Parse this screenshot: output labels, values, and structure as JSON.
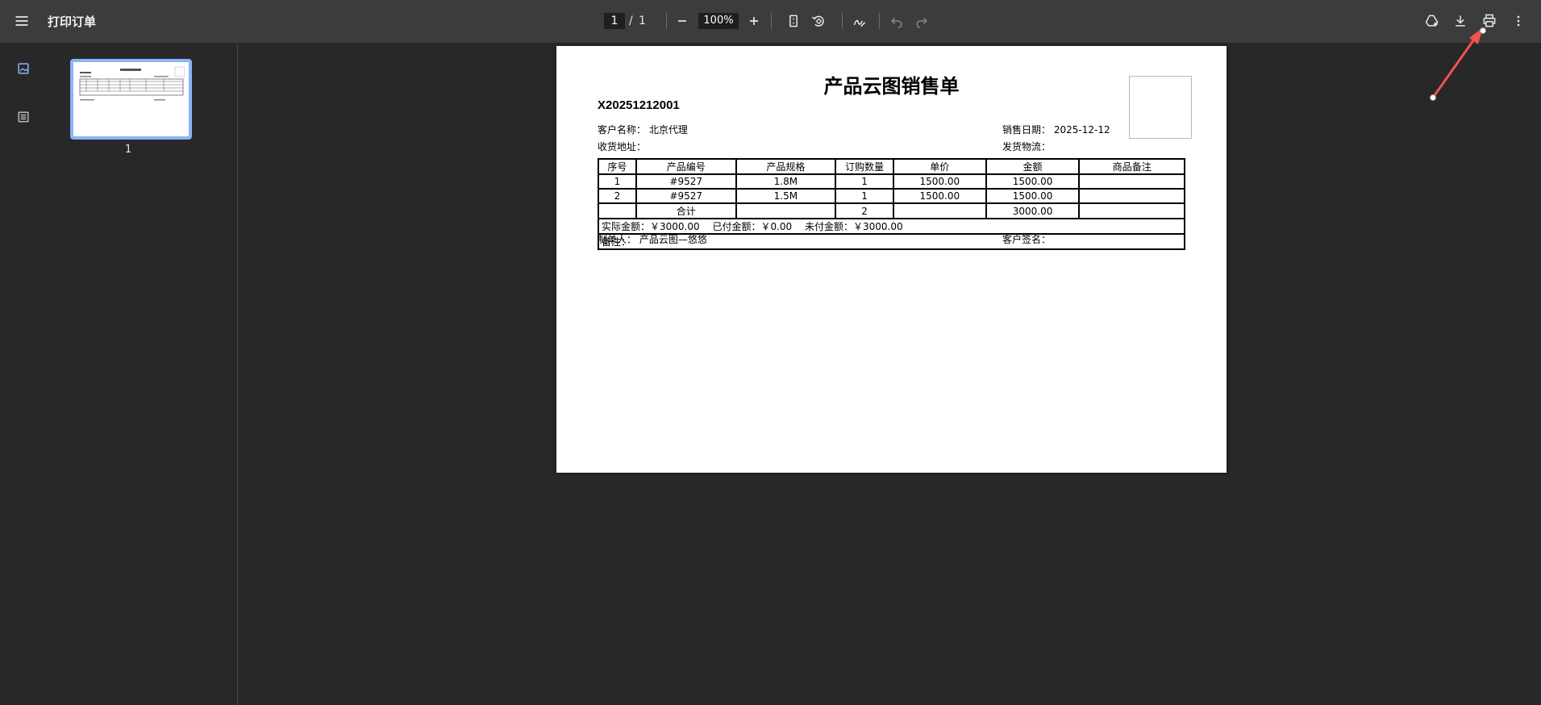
{
  "window": {
    "title": "打印订单"
  },
  "toolbar": {
    "current_page": "1",
    "page_separator": "/",
    "total_pages": "1",
    "zoom": "100%",
    "icons": [
      "menu-icon",
      "zoom-out-icon",
      "zoom-in-icon",
      "fit-page-icon",
      "rotate-icon",
      "annotate-icon",
      "undo-icon",
      "redo-icon",
      "drive-add-icon",
      "download-icon",
      "print-icon",
      "more-vert-icon"
    ]
  },
  "sidebar": {
    "thumbnail_label": "1"
  },
  "document": {
    "title": "产品云图销售单",
    "order_no": "X20251212001",
    "customer_label": "客户名称：",
    "customer_value": "北京代理",
    "address_label": "收货地址：",
    "address_value": "",
    "date_label": "销售日期：",
    "date_value": "2025-12-12",
    "logistics_label": "发货物流：",
    "logistics_value": "",
    "headers": [
      "序号",
      "产品编号",
      "产品规格",
      "订购数量",
      "单价",
      "金额",
      "商品备注"
    ],
    "rows": [
      [
        "1",
        "#9527",
        "1.8M",
        "1",
        "1500.00",
        "1500.00",
        ""
      ],
      [
        "2",
        "#9527",
        "1.5M",
        "1",
        "1500.00",
        "1500.00",
        ""
      ]
    ],
    "total_row": [
      "",
      "合计",
      "",
      "2",
      "",
      "3000.00",
      ""
    ],
    "summary": "实际金额：￥3000.00　 已付金额：￥0.00　 未付金额：￥3000.00",
    "remark": "备注：",
    "maker_label": "制单人：",
    "maker_value": "产品云图—悠悠",
    "sign_label": "客户签名："
  },
  "colors": {
    "toolbar_bg": "#3c3c3c",
    "viewer_bg": "#282828",
    "accent": "#8ab4f8",
    "arrow": "#ef5350"
  }
}
